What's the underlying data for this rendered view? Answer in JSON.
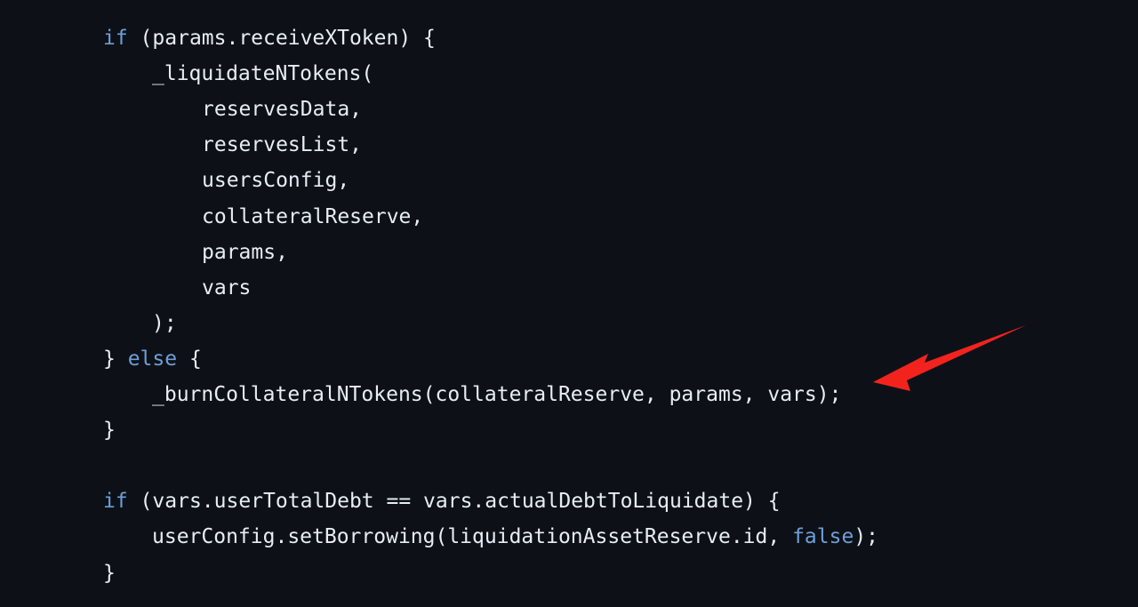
{
  "code": {
    "lines": [
      {
        "indent": 0,
        "tokens": [
          {
            "t": "if",
            "k": "kw"
          },
          {
            "t": " (params.receiveXToken) {",
            "k": "txt"
          }
        ]
      },
      {
        "indent": 1,
        "tokens": [
          {
            "t": "_liquidateNTokens(",
            "k": "txt"
          }
        ]
      },
      {
        "indent": 2,
        "tokens": [
          {
            "t": "reservesData,",
            "k": "txt"
          }
        ]
      },
      {
        "indent": 2,
        "tokens": [
          {
            "t": "reservesList,",
            "k": "txt"
          }
        ]
      },
      {
        "indent": 2,
        "tokens": [
          {
            "t": "usersConfig,",
            "k": "txt"
          }
        ]
      },
      {
        "indent": 2,
        "tokens": [
          {
            "t": "collateralReserve,",
            "k": "txt"
          }
        ]
      },
      {
        "indent": 2,
        "tokens": [
          {
            "t": "params,",
            "k": "txt"
          }
        ]
      },
      {
        "indent": 2,
        "tokens": [
          {
            "t": "vars",
            "k": "txt"
          }
        ]
      },
      {
        "indent": 1,
        "tokens": [
          {
            "t": ");",
            "k": "txt"
          }
        ]
      },
      {
        "indent": 0,
        "tokens": [
          {
            "t": "} ",
            "k": "txt"
          },
          {
            "t": "else",
            "k": "kw"
          },
          {
            "t": " {",
            "k": "txt"
          }
        ]
      },
      {
        "indent": 1,
        "tokens": [
          {
            "t": "_burnCollateralNTokens(collateralReserve, params, vars);",
            "k": "txt"
          }
        ]
      },
      {
        "indent": 0,
        "tokens": [
          {
            "t": "}",
            "k": "txt"
          }
        ]
      },
      {
        "indent": 0,
        "tokens": []
      },
      {
        "indent": 0,
        "tokens": [
          {
            "t": "if",
            "k": "kw"
          },
          {
            "t": " (vars.userTotalDebt == vars.actualDebtToLiquidate) {",
            "k": "txt"
          }
        ]
      },
      {
        "indent": 1,
        "tokens": [
          {
            "t": "userConfig.setBorrowing(liquidationAssetReserve.id, ",
            "k": "txt"
          },
          {
            "t": "false",
            "k": "kw"
          },
          {
            "t": ");",
            "k": "txt"
          }
        ]
      },
      {
        "indent": 0,
        "tokens": [
          {
            "t": "}",
            "k": "txt"
          }
        ]
      }
    ]
  },
  "colors": {
    "background": "#0d1117",
    "text": "#e6edf3",
    "keyword": "#6e9fd8",
    "arrow": "#f2231d"
  },
  "annotation": {
    "icon": "red-arrow-icon",
    "points_to_line": 11
  }
}
